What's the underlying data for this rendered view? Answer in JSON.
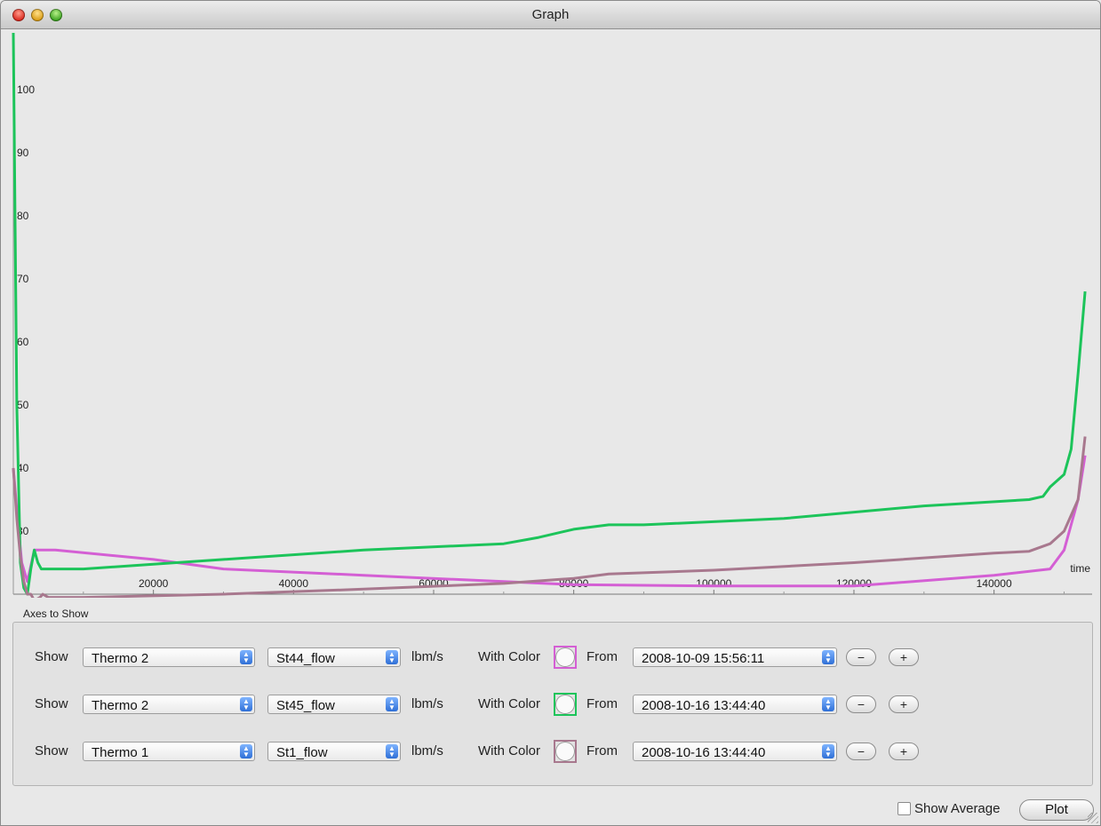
{
  "window": {
    "title": "Graph"
  },
  "controls": {
    "axes_label": "Axes to Show",
    "rows": [
      {
        "show_label": "Show",
        "source": "Thermo 2",
        "variable": "St44_flow",
        "unit": "lbm/s",
        "color_label": "With Color",
        "color": "#d45fd4",
        "from_label": "From",
        "from": "2008-10-09 15:56:11",
        "minus": "−",
        "plus": "+"
      },
      {
        "show_label": "Show",
        "source": "Thermo 2",
        "variable": "St45_flow",
        "unit": "lbm/s",
        "color_label": "With Color",
        "color": "#1cc45a",
        "from_label": "From",
        "from": "2008-10-16 13:44:40",
        "minus": "−",
        "plus": "+"
      },
      {
        "show_label": "Show",
        "source": "Thermo 1",
        "variable": "St1_flow",
        "unit": "lbm/s",
        "color_label": "With Color",
        "color": "#a8788e",
        "from_label": "From",
        "from": "2008-10-16 13:44:40",
        "minus": "−",
        "plus": "+"
      }
    ]
  },
  "footer": {
    "show_average_label": "Show Average",
    "plot_label": "Plot"
  },
  "chart_data": {
    "type": "line",
    "xlabel": "time",
    "ylabel": "",
    "xlim": [
      0,
      154000
    ],
    "ylim": [
      20,
      109
    ],
    "x_ticks": [
      20000,
      40000,
      60000,
      80000,
      100000,
      120000,
      140000
    ],
    "y_ticks": [
      30,
      40,
      50,
      60,
      70,
      80,
      90,
      100
    ],
    "grid": false,
    "series": [
      {
        "color": "#d45fd4",
        "points": [
          [
            0,
            40
          ],
          [
            600,
            32
          ],
          [
            1200,
            25
          ],
          [
            2000,
            22
          ],
          [
            2600,
            25
          ],
          [
            3000,
            27
          ],
          [
            4000,
            27
          ],
          [
            6000,
            27
          ],
          [
            20000,
            25.5
          ],
          [
            30000,
            24
          ],
          [
            50000,
            23
          ],
          [
            70000,
            22
          ],
          [
            80000,
            21.5
          ],
          [
            100000,
            21.3
          ],
          [
            120000,
            21.3
          ],
          [
            140000,
            23
          ],
          [
            148000,
            24
          ],
          [
            150000,
            27
          ],
          [
            152000,
            35
          ],
          [
            153000,
            42
          ]
        ]
      },
      {
        "color": "#1cc45a",
        "points": [
          [
            0,
            109
          ],
          [
            500,
            50
          ],
          [
            1000,
            25
          ],
          [
            1500,
            21
          ],
          [
            2000,
            20
          ],
          [
            2500,
            24
          ],
          [
            3000,
            27
          ],
          [
            3500,
            25
          ],
          [
            4000,
            24
          ],
          [
            10000,
            24
          ],
          [
            30000,
            25.5
          ],
          [
            50000,
            27
          ],
          [
            70000,
            28
          ],
          [
            75000,
            29
          ],
          [
            80000,
            30.3
          ],
          [
            85000,
            31
          ],
          [
            90000,
            31
          ],
          [
            110000,
            32
          ],
          [
            130000,
            34
          ],
          [
            145000,
            35
          ],
          [
            147000,
            35.5
          ],
          [
            148000,
            37
          ],
          [
            150000,
            39
          ],
          [
            151000,
            43
          ],
          [
            152000,
            55
          ],
          [
            153000,
            68
          ]
        ]
      },
      {
        "color": "#a8788e",
        "points": [
          [
            0,
            40
          ],
          [
            500,
            32
          ],
          [
            1000,
            26
          ],
          [
            1500,
            22
          ],
          [
            2000,
            20
          ],
          [
            2500,
            20
          ],
          [
            3000,
            19
          ],
          [
            3800,
            19.5
          ],
          [
            4200,
            20
          ],
          [
            5000,
            19.5
          ],
          [
            10000,
            19.5
          ],
          [
            30000,
            20
          ],
          [
            50000,
            20.8
          ],
          [
            70000,
            21.7
          ],
          [
            80000,
            22.5
          ],
          [
            85000,
            23.2
          ],
          [
            100000,
            23.8
          ],
          [
            120000,
            25
          ],
          [
            140000,
            26.5
          ],
          [
            145000,
            26.8
          ],
          [
            148000,
            28
          ],
          [
            150000,
            30
          ],
          [
            152000,
            35
          ],
          [
            153000,
            45
          ]
        ]
      }
    ]
  }
}
